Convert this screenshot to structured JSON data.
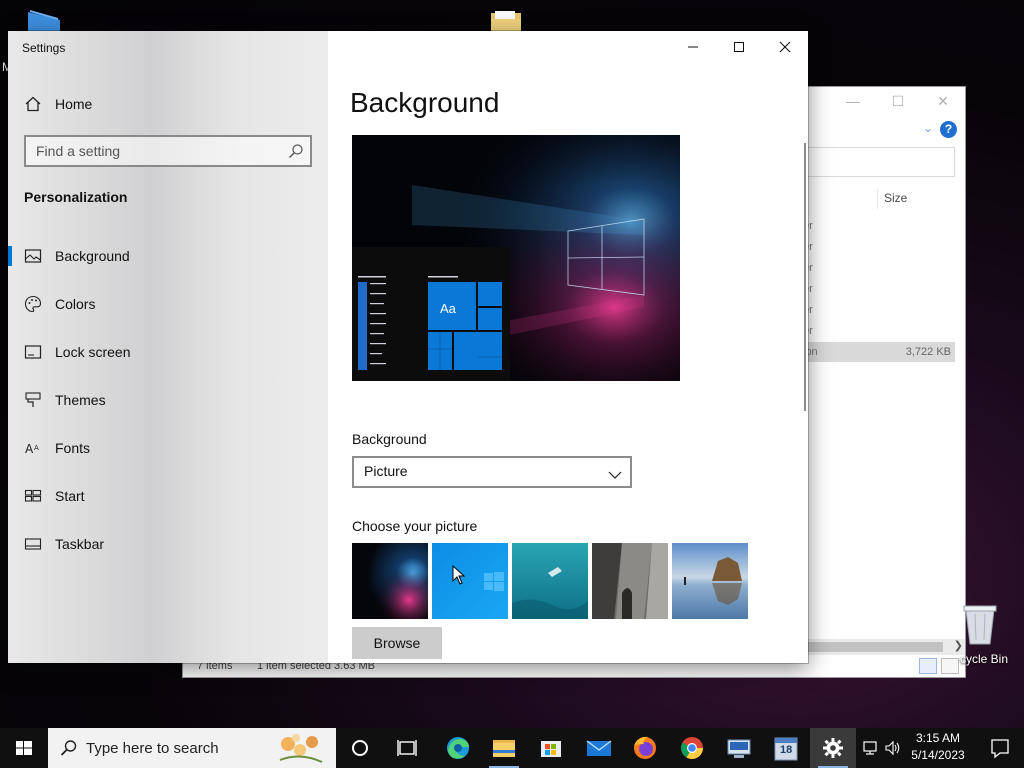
{
  "desktop": {
    "top_icon_label_fragment": "M",
    "recycle_bin_label": "cycle Bin"
  },
  "explorer": {
    "size_header": "Size",
    "rows": [
      {
        "name": "er",
        "size": ""
      },
      {
        "name": "er",
        "size": ""
      },
      {
        "name": "er",
        "size": ""
      },
      {
        "name": "er",
        "size": ""
      },
      {
        "name": "er",
        "size": ""
      },
      {
        "name": "er",
        "size": ""
      },
      {
        "name": "ion",
        "size": "3,722 KB",
        "selected": true
      }
    ],
    "status": {
      "items": "7 items",
      "selected": "1 item selected  3.63 MB"
    },
    "help_label": "?"
  },
  "settings": {
    "window_title": "Settings",
    "home_label": "Home",
    "search_placeholder": "Find a setting",
    "section_header": "Personalization",
    "nav_items": [
      {
        "label": "Background",
        "icon": "picture-icon",
        "active": true
      },
      {
        "label": "Colors",
        "icon": "palette-icon",
        "active": false
      },
      {
        "label": "Lock screen",
        "icon": "lock-screen-icon",
        "active": false
      },
      {
        "label": "Themes",
        "icon": "brush-icon",
        "active": false
      },
      {
        "label": "Fonts",
        "icon": "font-icon",
        "active": false
      },
      {
        "label": "Start",
        "icon": "start-icon",
        "active": false
      },
      {
        "label": "Taskbar",
        "icon": "taskbar-icon",
        "active": false
      }
    ],
    "page_title": "Background",
    "preview_tile_text": "Aa",
    "background_label": "Background",
    "background_value": "Picture",
    "choose_picture_label": "Choose your picture",
    "browse_label": "Browse",
    "accent_color": "#0078d4"
  },
  "taskbar": {
    "search_placeholder": "Type here to search",
    "time": "3:15 AM",
    "date": "5/14/2023",
    "badge_count": "18",
    "apps": [
      "cortana-icon",
      "task-view-icon",
      "edge-icon",
      "file-explorer-icon",
      "store-icon",
      "mail-icon",
      "firefox-icon",
      "chrome-icon",
      "network-app-icon",
      "calendar-app-icon",
      "settings-gear-icon"
    ]
  }
}
